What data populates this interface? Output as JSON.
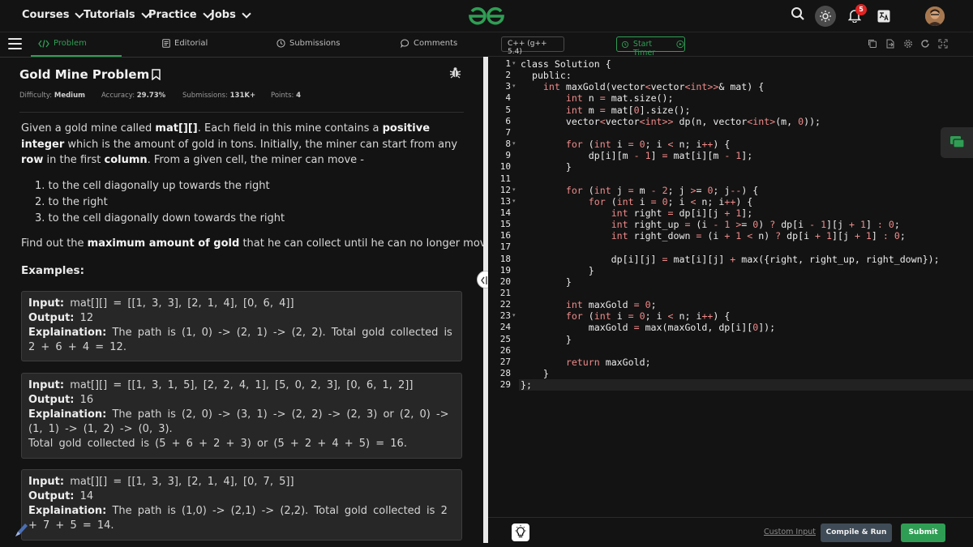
{
  "nav": {
    "items": [
      "Courses",
      "Tutorials",
      "Practice",
      "Jobs"
    ],
    "notification_count": "5"
  },
  "tabs": [
    {
      "label": "Problem",
      "icon": "code-icon"
    },
    {
      "label": "Editorial",
      "icon": "document-icon"
    },
    {
      "label": "Submissions",
      "icon": "clock-icon"
    },
    {
      "label": "Comments",
      "icon": "comment-icon"
    }
  ],
  "problem": {
    "title": "Gold Mine Problem",
    "difficulty_label": "Difficulty:",
    "difficulty": "Medium",
    "accuracy_label": "Accuracy:",
    "accuracy": "29.73%",
    "submissions_label": "Submissions:",
    "submissions": "131K+",
    "points_label": "Points:",
    "points": "4",
    "desc_1": "Given a gold mine called ",
    "desc_mat": "mat[][]",
    "desc_2": ". Each field in this mine contains a ",
    "desc_pos": "positive integer",
    "desc_3": " which is the amount of gold in tons. Initially, the miner can start from any ",
    "desc_row": "row",
    "desc_4": " in the first ",
    "desc_col": "column",
    "desc_5": ". From a given cell, the miner can move -",
    "moves": [
      "1. to the cell diagonally up towards the right",
      "2. to the right",
      "3. to the cell diagonally down towards the right"
    ],
    "find_1": "Find out the ",
    "find_bold": "maximum amount of gold",
    "find_2": " that he can collect until he can no longer move.",
    "examples_heading": "Examples:"
  },
  "examples": [
    {
      "input_label": "Input:",
      "input": " mat[][] = [[1, 3, 3], [2, 1, 4], [0, 6, 4]]",
      "output_label": "Output:",
      "output": " 12",
      "expl_label": "Explaination:",
      "expl": " The path is (1, 0) -> (2, 1) -> (2, 2). Total gold collected is 2 + 6 + 4 = 12.",
      "extra": ""
    },
    {
      "input_label": "Input:",
      "input": " mat[][] = [[1, 3, 1, 5], [2, 2, 4, 1], [5, 0, 2, 3], [0, 6, 1, 2]]",
      "output_label": "Output:",
      "output": " 16",
      "expl_label": "Explaination:",
      "expl": " The path is (2, 0) -> (3, 1) -> (2, 2) -> (2, 3) or (2, 0) -> (1, 1) -> (1, 2) -> (0, 3).",
      "extra": "Total gold collected is (5 + 6 + 2 + 3) or (5 + 2 + 4 + 5) = 16."
    },
    {
      "input_label": "Input:",
      "input": " mat[][] = [[1, 3, 3], [2, 1, 4], [0, 7, 5]]",
      "output_label": "Output:",
      "output": " 14",
      "expl_label": "Explaination:",
      "expl": " The path is (1,0) -> (2,1) -> (2,2). Total gold collected is 2 + 7 + 5 = 14.",
      "extra": ""
    }
  ],
  "editor": {
    "language": "C++ (g++ 5.4)",
    "timer_label": "Start Timer",
    "custom_input": "Custom Input",
    "compile_run": "Compile & Run",
    "submit": "Submit"
  },
  "code_lines": [
    "class Solution {",
    "  public:",
    "    int maxGold(vector<vector<int>>& mat) {",
    "        int n = mat.size();",
    "        int m = mat[0].size();",
    "        vector<vector<int>> dp(n, vector<int>(m, 0));",
    "",
    "        for (int i = 0; i < n; i++) {",
    "            dp[i][m - 1] = mat[i][m - 1];",
    "        }",
    "",
    "        for (int j = m - 2; j >= 0; j--) {",
    "            for (int i = 0; i < n; i++) {",
    "                int right = dp[i][j + 1];",
    "                int right_up = (i - 1 >= 0) ? dp[i - 1][j + 1] : 0;",
    "                int right_down = (i + 1 < n) ? dp[i + 1][j + 1] : 0;",
    "",
    "                dp[i][j] = mat[i][j] + max({right, right_up, right_down});",
    "            }",
    "        }",
    "",
    "        int maxGold = 0;",
    "        for (int i = 0; i < n; i++) {",
    "            maxGold = max(maxGold, dp[i][0]);",
    "        }",
    "",
    "        return maxGold;",
    "    }",
    "};"
  ],
  "fold_lines": [
    1,
    3,
    8,
    12,
    13,
    23
  ]
}
